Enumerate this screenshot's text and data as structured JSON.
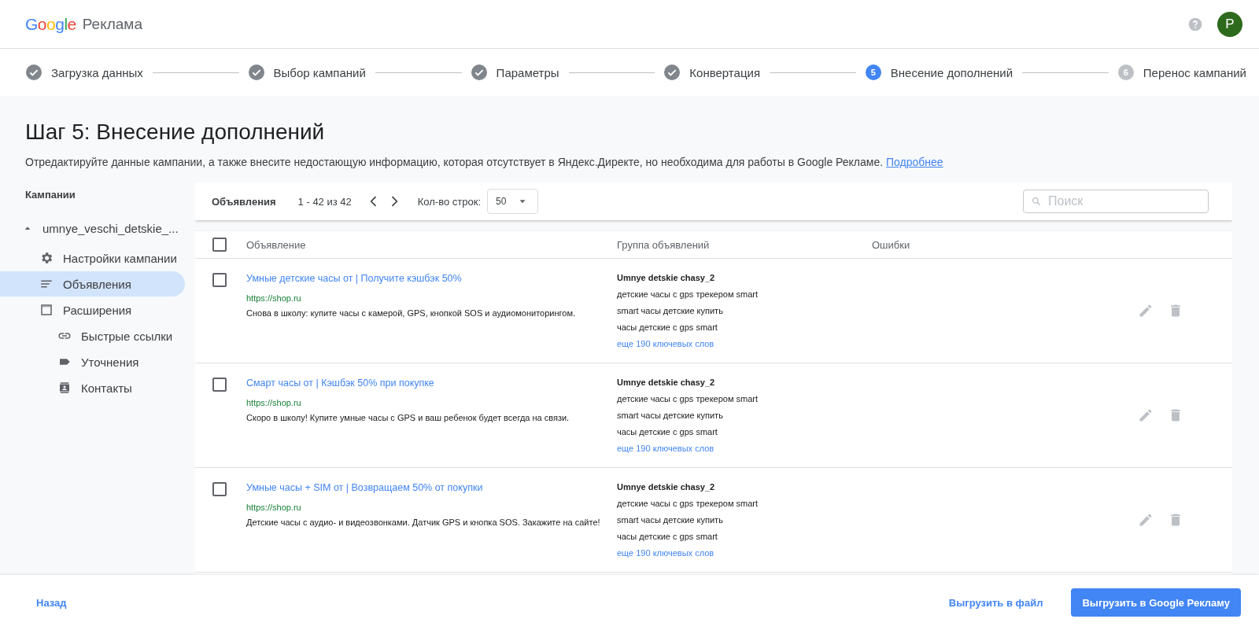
{
  "header": {
    "logo": "Google",
    "product": "Реклама",
    "avatar": "P"
  },
  "steps": [
    {
      "label": "Загрузка данных",
      "kind": "done"
    },
    {
      "label": "Выбор кампаний",
      "kind": "done"
    },
    {
      "label": "Параметры",
      "kind": "done"
    },
    {
      "label": "Конвертация",
      "kind": "done"
    },
    {
      "number": "5",
      "label": "Внесение дополнений",
      "kind": "current"
    },
    {
      "number": "6",
      "label": "Перенос кампаний",
      "kind": "pending"
    }
  ],
  "page": {
    "title": "Шаг 5: Внесение дополнений",
    "description": "Отредактируйте данные кампании, а также внесите недостающую информацию, которая отсутствует в Яндекс.Директе, но необходима для работы в Google Рекламе.",
    "link": "Подробнее"
  },
  "sidebar": {
    "heading": "Кампании",
    "campaign": {
      "label": "umnye_veschi_detskie_...",
      "expanded": true,
      "children": [
        {
          "label": "Настройки кампании",
          "kind": "settings",
          "selected": false
        },
        {
          "label": "Объявления",
          "kind": "ads",
          "selected": true
        },
        {
          "label": "Расширения",
          "kind": "extensions",
          "selected": false,
          "children": [
            {
              "label": "Быстрые ссылки",
              "kind": "sitelinks",
              "selected": false
            },
            {
              "label": "Уточнения",
              "kind": "callouts",
              "selected": false
            },
            {
              "label": "Контакты",
              "kind": "contacts",
              "selected": false
            }
          ]
        }
      ]
    }
  },
  "toolbar": {
    "title": "Объявления",
    "range": "1 - 42 из 42",
    "rows_label": "Кол-во строк:",
    "rows_value": "50",
    "search_placeholder": "Поиск"
  },
  "table": {
    "columns": [
      "Объявление",
      "Группа объявлений",
      "Ошибки"
    ],
    "header_checked": false,
    "rows": [
      {
        "checked": false,
        "headline": "Умные детские часы от | Получите кэшбэк 50%",
        "url": "https://shop.ru",
        "description": "Снова в школу: купите часы с камерой, GPS, кнопкой SOS и аудиомониторингом.",
        "group": "Umnye detskie chasy_2",
        "keywords": [
          "детские часы с gps трекером smart",
          "smart часы детские купить",
          "часы детские с gps smart"
        ],
        "more": "еще 190 ключевых слов"
      },
      {
        "checked": false,
        "headline": "Смарт часы от | Кэшбэк 50% при покупке",
        "url": "https://shop.ru",
        "description": "Скоро в школу! Купите умные часы с GPS и ваш ребенок будет всегда на связи.",
        "group": "Umnye detskie chasy_2",
        "keywords": [
          "детские часы с gps трекером smart",
          "smart часы детские купить",
          "часы детские с gps smart"
        ],
        "more": "еще 190 ключевых слов"
      },
      {
        "checked": false,
        "headline": "Умные часы + SIM от | Возвращаем 50% от покупки",
        "url": "https://shop.ru",
        "description": "Детские часы с аудио- и видеозвонками. Датчик GPS и кнопка SOS. Закажите на сайте!",
        "group": "Umnye detskie chasy_2",
        "keywords": [
          "детские часы с gps трекером smart",
          "smart часы детские купить",
          "часы детские с gps smart"
        ],
        "more": "еще 190 ключевых слов"
      }
    ]
  },
  "footer": {
    "back": "Назад",
    "export_file": "Выгрузить в файл",
    "export_ads": "Выгрузить в Google Рекламу"
  }
}
